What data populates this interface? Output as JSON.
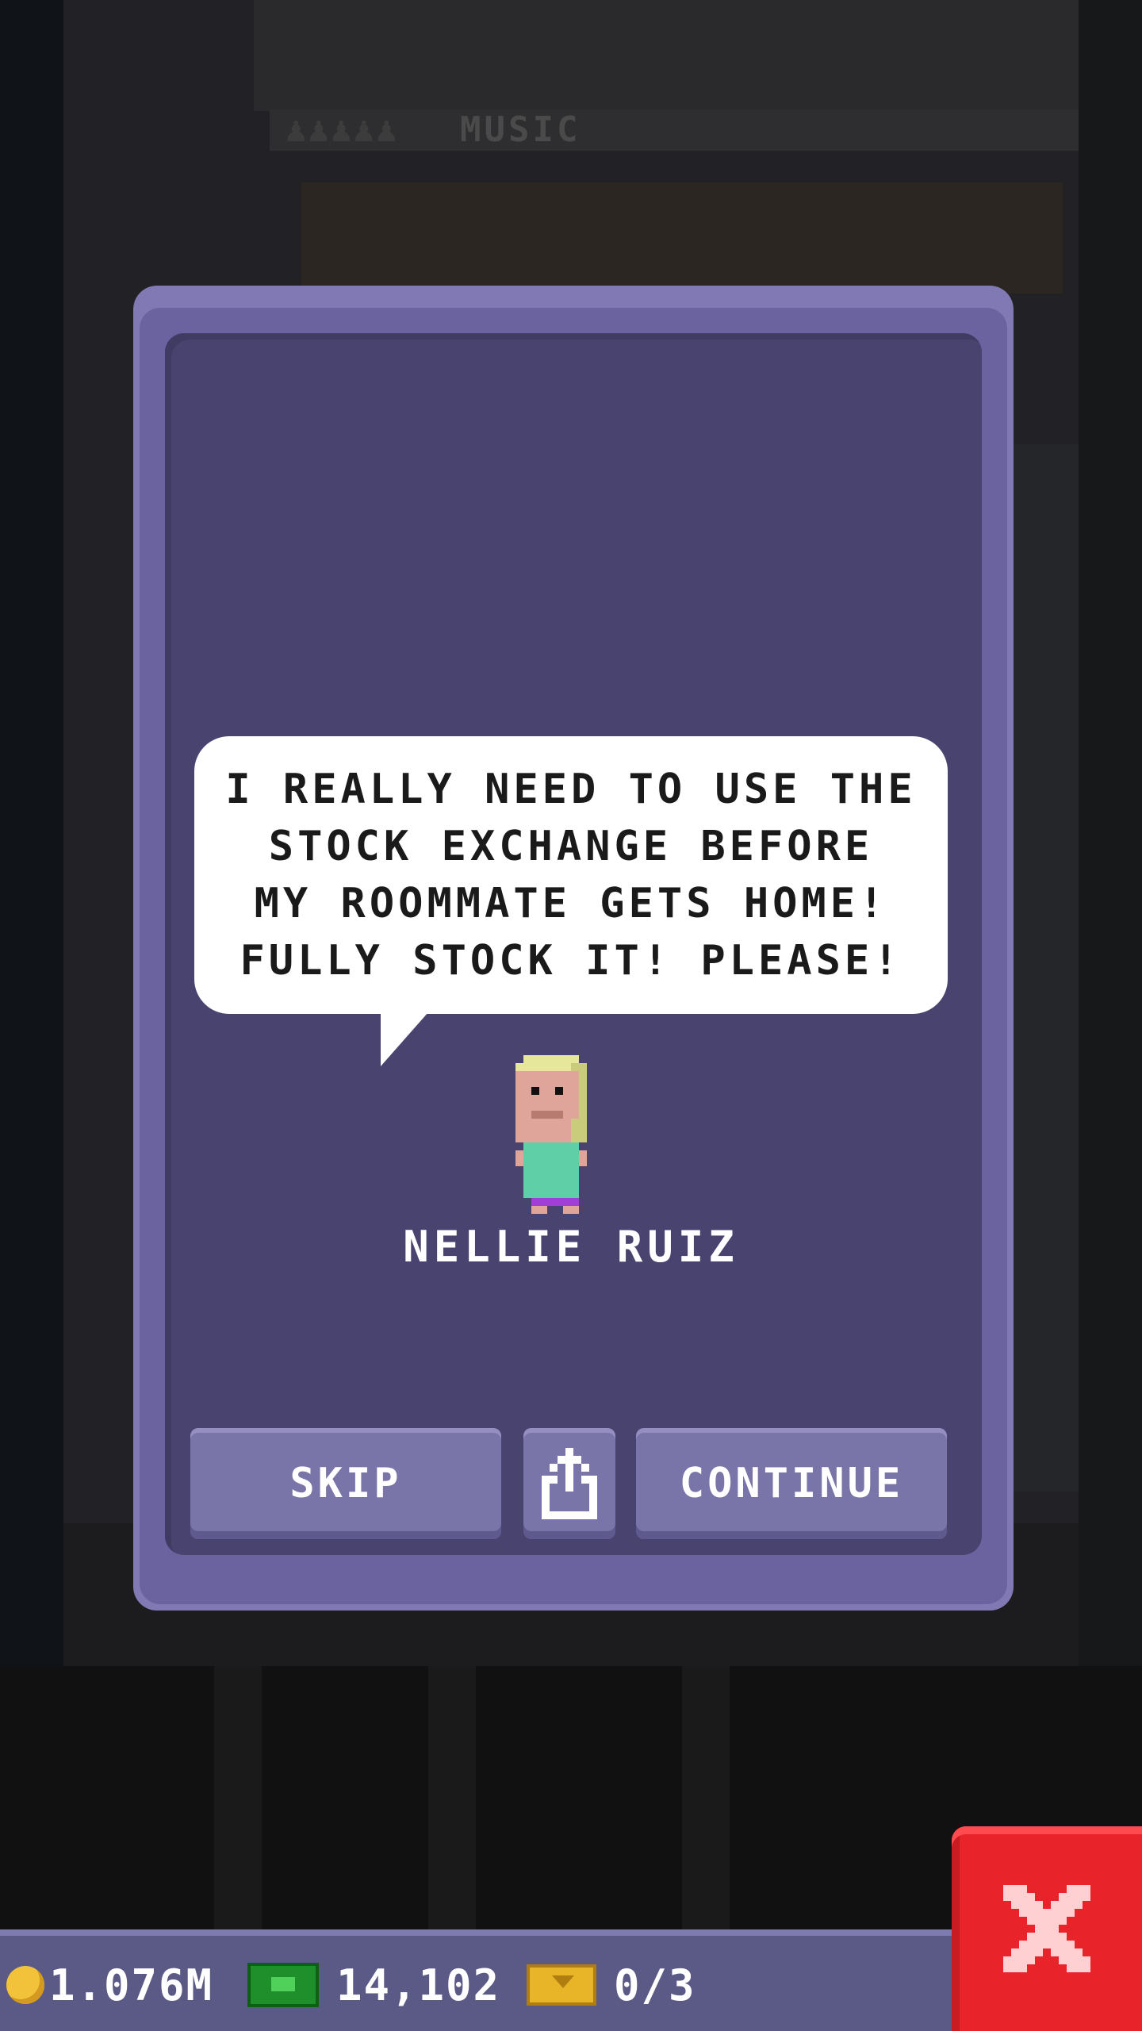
{
  "background": {
    "floor_label": "MUSIC"
  },
  "dialog": {
    "speech_lines": [
      "I REALLY NEED TO USE THE",
      "STOCK EXCHANGE BEFORE",
      "MY ROOMMATE GETS HOME!",
      "FULLY STOCK IT! PLEASE!"
    ],
    "character_name": "NELLIE RUIZ",
    "buttons": {
      "skip_label": "SKIP",
      "share_icon": "share-icon",
      "continue_label": "CONTINUE"
    }
  },
  "status_bar": {
    "coins": "1.076M",
    "cash": "14,102",
    "tickets": "0/3",
    "icons": [
      "coin-icon",
      "cash-icon",
      "ticket-icon"
    ]
  },
  "close_button": {
    "icon": "close-icon"
  },
  "colors": {
    "dialog_outer": "#8079b3",
    "dialog_inner": "#49446f",
    "button": "#7a75a8",
    "bottom_bar": "#5b5a86",
    "close_red": "#e8242a"
  }
}
